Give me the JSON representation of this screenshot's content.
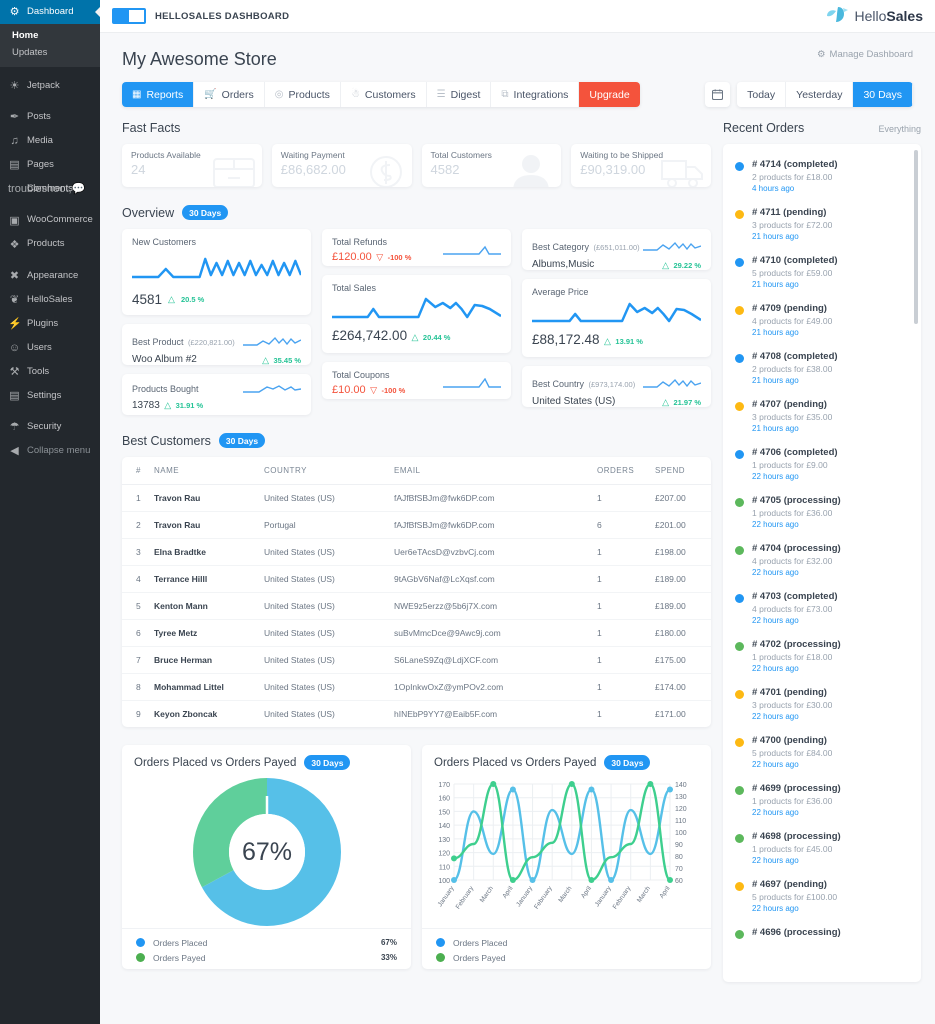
{
  "wp_sidebar": {
    "items": [
      {
        "label": "Dashboard",
        "icon": "dashboard-icon",
        "glyph": "⚙",
        "current": true
      },
      {
        "label": "Jetpack",
        "icon": "jetpack-icon",
        "glyph": "◕"
      },
      {
        "label": "Posts",
        "icon": "pin-icon",
        "glyph": "✐"
      },
      {
        "label": "Media",
        "icon": "media-icon",
        "glyph": "♪"
      },
      {
        "label": "Pages",
        "icon": "pages-icon",
        "glyph": "▤"
      },
      {
        "label": "Comments",
        "icon": "comment-icon",
        "glyph": "⚐"
      },
      {
        "label": "WooCommerce",
        "icon": "woocommerce-icon",
        "glyph": "▣"
      },
      {
        "label": "Products",
        "icon": "products-icon",
        "glyph": "❖"
      },
      {
        "label": "Appearance",
        "icon": "brush-icon",
        "glyph": "✎"
      },
      {
        "label": "HelloSales",
        "icon": "hellosales-icon",
        "glyph": "❦"
      },
      {
        "label": "Plugins",
        "icon": "plugins-icon",
        "glyph": "⚡"
      },
      {
        "label": "Users",
        "icon": "users-icon",
        "glyph": "☺"
      },
      {
        "label": "Tools",
        "icon": "tools-icon",
        "glyph": "⚒"
      },
      {
        "label": "Settings",
        "icon": "settings-icon",
        "glyph": "☲"
      },
      {
        "label": "Security",
        "icon": "shield-icon",
        "glyph": "⛨"
      },
      {
        "label": "Collapse menu",
        "icon": "collapse-icon",
        "glyph": "◀"
      }
    ],
    "submenu": {
      "home": "Home",
      "updates": "Updates"
    }
  },
  "topbar": {
    "title": "HELLOSALES DASHBOARD",
    "logo_text_light": "Hello",
    "logo_text_bold": "Sales"
  },
  "page": {
    "title": "My Awesome Store",
    "manage_label": "Manage Dashboard"
  },
  "toolbar": {
    "tabs": [
      {
        "label": "Reports",
        "icon": "reports-icon",
        "glyph": "▦",
        "active": true
      },
      {
        "label": "Orders",
        "icon": "cart-icon",
        "glyph": "Ὥ2"
      },
      {
        "label": "Products",
        "icon": "tag-icon",
        "glyph": "◎"
      },
      {
        "label": "Customers",
        "icon": "customers-icon",
        "glyph": "☻"
      },
      {
        "label": "Digest",
        "icon": "list-icon",
        "glyph": "☰"
      },
      {
        "label": "Integrations",
        "icon": "integrations-icon",
        "glyph": "⧉"
      }
    ],
    "upgrade_label": "Upgrade",
    "calendar_icon": "calendar-icon",
    "ranges": [
      {
        "label": "Today",
        "active": false
      },
      {
        "label": "Yesterday",
        "active": false
      },
      {
        "label": "30 Days",
        "active": true
      }
    ]
  },
  "fast_facts": {
    "title": "Fast Facts",
    "cards": [
      {
        "label": "Products Available",
        "value": "24",
        "art": "box-icon"
      },
      {
        "label": "Waiting Payment",
        "value": "£86,682.00",
        "art": "money-icon"
      },
      {
        "label": "Total Customers",
        "value": "4582",
        "art": "person-icon"
      },
      {
        "label": "Waiting to be Shipped",
        "value": "£90,319.00",
        "art": "truck-icon"
      }
    ]
  },
  "overview": {
    "title": "Overview",
    "badge": "30 Days",
    "new_customers": {
      "label": "New Customers",
      "value": "4581",
      "delta": "20.5 %",
      "dir": "up"
    },
    "best_product": {
      "label": "Best Product",
      "amount": "(£220,821.00)",
      "value": "Woo Album #2",
      "delta": "35.45 %",
      "dir": "up"
    },
    "products_bought": {
      "label": "Products Bought",
      "value": "13783",
      "delta": "31.91 %",
      "dir": "up"
    },
    "total_refunds": {
      "label": "Total Refunds",
      "value": "£120.00",
      "delta": "-100 %",
      "dir": "down"
    },
    "total_sales": {
      "label": "Total Sales",
      "value": "£264,742.00",
      "delta": "20.44 %",
      "dir": "up"
    },
    "total_coupons": {
      "label": "Total Coupons",
      "value": "£10.00",
      "delta": "-100 %",
      "dir": "down"
    },
    "best_category": {
      "label": "Best Category",
      "amount": "(£651,011.00)",
      "value": "Albums,Music",
      "delta": "29.22 %",
      "dir": "up"
    },
    "average_price": {
      "label": "Average Price",
      "value": "£88,172.48",
      "delta": "13.91 %",
      "dir": "up"
    },
    "best_country": {
      "label": "Best Country",
      "amount": "(£973,174.00)",
      "value": "United States (US)",
      "delta": "21.97 %",
      "dir": "up"
    }
  },
  "best_customers": {
    "title": "Best Customers",
    "badge": "30 Days",
    "columns": [
      "#",
      "NAME",
      "COUNTRY",
      "EMAIL",
      "ORDERS",
      "SPEND"
    ],
    "rows": [
      {
        "n": "1",
        "name": "Travon Rau",
        "country": "United States (US)",
        "email": "fAJfBfSBJm@fwk6DP.com",
        "orders": "1",
        "spend": "£207.00"
      },
      {
        "n": "2",
        "name": "Travon Rau",
        "country": "Portugal",
        "email": "fAJfBfSBJm@fwk6DP.com",
        "orders": "6",
        "spend": "£201.00"
      },
      {
        "n": "3",
        "name": "Elna Bradtke",
        "country": "United States (US)",
        "email": "Uer6eTAcsD@vzbvCj.com",
        "orders": "1",
        "spend": "£198.00"
      },
      {
        "n": "4",
        "name": "Terrance Hilll",
        "country": "United States (US)",
        "email": "9tAGbV6Naf@LcXqsf.com",
        "orders": "1",
        "spend": "£189.00"
      },
      {
        "n": "5",
        "name": "Kenton Mann",
        "country": "United States (US)",
        "email": "NWE9z5erzz@5b6j7X.com",
        "orders": "1",
        "spend": "£189.00"
      },
      {
        "n": "6",
        "name": "Tyree Metz",
        "country": "United States (US)",
        "email": "suBvMmcDce@9Awc9j.com",
        "orders": "1",
        "spend": "£180.00"
      },
      {
        "n": "7",
        "name": "Bruce Herman",
        "country": "United States (US)",
        "email": "S6LaneS9Zq@LdjXCF.com",
        "orders": "1",
        "spend": "£175.00"
      },
      {
        "n": "8",
        "name": "Mohammad Littel",
        "country": "United States (US)",
        "email": "1OpInkwOxZ@ymPOv2.com",
        "orders": "1",
        "spend": "£174.00"
      },
      {
        "n": "9",
        "name": "Keyon Zboncak",
        "country": "United States (US)",
        "email": "hINEbP9YY7@Eaib5F.com",
        "orders": "1",
        "spend": "£171.00"
      }
    ]
  },
  "recent_orders": {
    "title": "Recent Orders",
    "filter_label": "Everything",
    "items": [
      {
        "id": "# 4714",
        "status": "(completed)",
        "meta": "2 products for £18.00",
        "time": "4 hours ago",
        "color": "#2196f3"
      },
      {
        "id": "# 4711",
        "status": "(pending)",
        "meta": "3 products for £72.00",
        "time": "21 hours ago",
        "color": "#fdb913"
      },
      {
        "id": "# 4710",
        "status": "(completed)",
        "meta": "5 products for £59.00",
        "time": "21 hours ago",
        "color": "#2196f3"
      },
      {
        "id": "# 4709",
        "status": "(pending)",
        "meta": "4 products for £49.00",
        "time": "21 hours ago",
        "color": "#fdb913"
      },
      {
        "id": "# 4708",
        "status": "(completed)",
        "meta": "2 products for £38.00",
        "time": "21 hours ago",
        "color": "#2196f3"
      },
      {
        "id": "# 4707",
        "status": "(pending)",
        "meta": "3 products for £35.00",
        "time": "21 hours ago",
        "color": "#fdb913"
      },
      {
        "id": "# 4706",
        "status": "(completed)",
        "meta": "1 products for £9.00",
        "time": "22 hours ago",
        "color": "#2196f3"
      },
      {
        "id": "# 4705",
        "status": "(processing)",
        "meta": "1 products for £36.00",
        "time": "22 hours ago",
        "color": "#5cb85c"
      },
      {
        "id": "# 4704",
        "status": "(processing)",
        "meta": "4 products for £32.00",
        "time": "22 hours ago",
        "color": "#5cb85c"
      },
      {
        "id": "# 4703",
        "status": "(completed)",
        "meta": "4 products for £73.00",
        "time": "22 hours ago",
        "color": "#2196f3"
      },
      {
        "id": "# 4702",
        "status": "(processing)",
        "meta": "1 products for £18.00",
        "time": "22 hours ago",
        "color": "#5cb85c"
      },
      {
        "id": "# 4701",
        "status": "(pending)",
        "meta": "3 products for £30.00",
        "time": "22 hours ago",
        "color": "#fdb913"
      },
      {
        "id": "# 4700",
        "status": "(pending)",
        "meta": "5 products for £84.00",
        "time": "22 hours ago",
        "color": "#fdb913"
      },
      {
        "id": "# 4699",
        "status": "(processing)",
        "meta": "1 products for £36.00",
        "time": "22 hours ago",
        "color": "#5cb85c"
      },
      {
        "id": "# 4698",
        "status": "(processing)",
        "meta": "1 products for £45.00",
        "time": "22 hours ago",
        "color": "#5cb85c"
      },
      {
        "id": "# 4697",
        "status": "(pending)",
        "meta": "5 products for £100.00",
        "time": "22 hours ago",
        "color": "#fdb913"
      },
      {
        "id": "# 4696",
        "status": "(processing)",
        "meta": "",
        "time": "",
        "color": "#5cb85c"
      }
    ]
  },
  "chart_data": [
    {
      "type": "pie",
      "title": "Orders Placed vs Orders Payed",
      "badge": "30 Days",
      "center_label": "67%",
      "labels": [
        "Orders Placed",
        "Orders Payed"
      ],
      "values": [
        67,
        33
      ],
      "value_labels": [
        "67%",
        "33%"
      ],
      "colors": [
        "#56c0e8",
        "#5fcf9b"
      ],
      "legend": "bottom"
    },
    {
      "type": "line",
      "title": "Orders Placed vs Orders Payed",
      "badge": "30 Days",
      "x": [
        "January",
        "February",
        "March",
        "April",
        "January",
        "February",
        "March",
        "April",
        "January",
        "February",
        "March",
        "April"
      ],
      "xlabel": "",
      "ylabel": "",
      "y_left_ticks": [
        100,
        110,
        120,
        130,
        140,
        150,
        160,
        170
      ],
      "y_right_ticks": [
        60,
        70,
        80,
        90,
        100,
        110,
        120,
        130,
        140
      ],
      "ylim_left": [
        100,
        170
      ],
      "ylim_right": [
        60,
        140
      ],
      "grid": true,
      "legend": "bottom",
      "series": [
        {
          "name": "Orders Placed",
          "color": "#56c0e8",
          "axis": "left",
          "values": [
            100,
            150,
            119,
            166,
            100,
            151,
            119,
            166,
            100,
            151,
            119,
            166
          ]
        },
        {
          "name": "Orders Payed",
          "color": "#3ecf8e",
          "axis": "right",
          "values": [
            78,
            90,
            140,
            60,
            79,
            91,
            140,
            60,
            79,
            90,
            140,
            60
          ]
        }
      ]
    }
  ]
}
